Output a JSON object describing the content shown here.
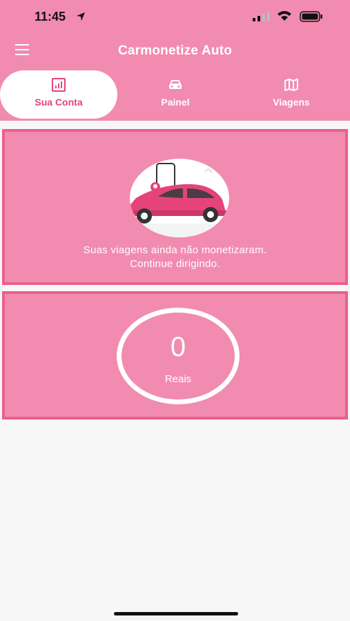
{
  "status_bar": {
    "time": "11:45"
  },
  "app_bar": {
    "title": "Carmonetize Auto",
    "menu_icon": "hamburger-menu-icon"
  },
  "tabs": [
    {
      "label": "Sua Conta",
      "icon": "chart-icon",
      "active": true
    },
    {
      "label": "Painel",
      "icon": "car-icon",
      "active": false
    },
    {
      "label": "Viagens",
      "icon": "map-icon",
      "active": false
    }
  ],
  "trips_card": {
    "illustration": "car-location-illustration",
    "message_line1": "Suas viagens ainda não monetizaram.",
    "message_line2": "Continue dirigindo."
  },
  "earnings_card": {
    "amount": "0",
    "currency": "Reais"
  },
  "colors": {
    "primary": "#f28bb0",
    "accent": "#e5437a",
    "border": "#ea5f8f",
    "background": "#f7f7f7"
  }
}
